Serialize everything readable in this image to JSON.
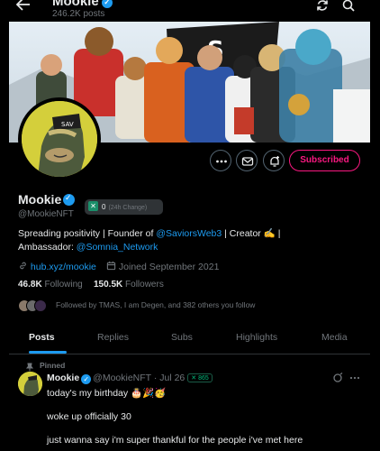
{
  "topbar": {
    "name": "Mookie",
    "posts_count": "246.2K posts",
    "icons": [
      "back-arrow-icon",
      "sync-icon",
      "search-icon"
    ]
  },
  "profile": {
    "name": "Mookie",
    "handle": "@MookieNFT",
    "pill_value": "0",
    "pill_caption": "(24h Change)",
    "bio_part1": "Spreading positivity | Founder of ",
    "bio_mention1": "@SaviorsWeb3",
    "bio_part2": " | Creator ✍️ |",
    "bio_part3": "Ambassador: ",
    "bio_mention2": "@Somnia_Network",
    "website": "hub.xyz/mookie",
    "joined": "Joined September 2021",
    "following_count": "46.8K",
    "following_label": "Following",
    "followers_count": "150.5K",
    "followers_label": "Followers",
    "followed_by": "Followed by TMAS, I am Degen, and 382 others you follow",
    "subscribed_label": "Subscribed"
  },
  "tabs": [
    {
      "label": "Posts",
      "active": true
    },
    {
      "label": "Replies"
    },
    {
      "label": "Subs"
    },
    {
      "label": "Highlights"
    },
    {
      "label": "Media"
    }
  ],
  "pinned_post": {
    "pinned_label": "Pinned",
    "author": "Mookie",
    "handle_date": "@MookieNFT · Jul 26",
    "badge": "865",
    "line1": "today's my birthday 🎂🎉🥳",
    "line2": "woke up officially 30",
    "line3": "just wanna say i'm super thankful for the people i've met here"
  },
  "colors": {
    "accent": "#1d9bf0",
    "subscribe": "#f91880",
    "muted": "#71767b",
    "avatar_bg": "#d4cf3b"
  }
}
